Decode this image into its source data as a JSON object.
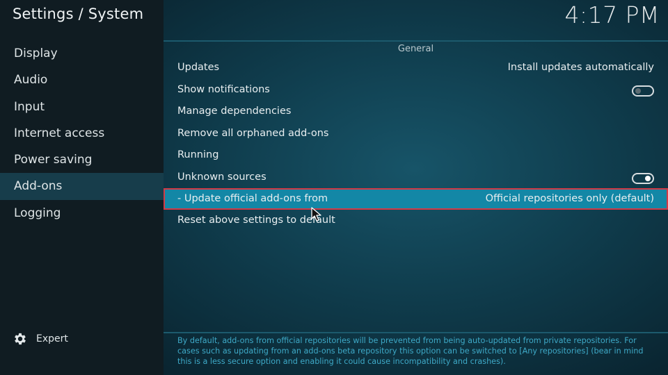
{
  "header": {
    "title": "Settings / System",
    "clock": "4:17 PM"
  },
  "sidebar": {
    "items": [
      {
        "label": "Display"
      },
      {
        "label": "Audio"
      },
      {
        "label": "Input"
      },
      {
        "label": "Internet access"
      },
      {
        "label": "Power saving"
      },
      {
        "label": "Add-ons",
        "active": true
      },
      {
        "label": "Logging"
      }
    ],
    "expert_label": "Expert",
    "expert_icon": "gear-icon"
  },
  "main": {
    "section": "General",
    "rows": [
      {
        "label": "Updates",
        "value": "Install updates automatically"
      },
      {
        "label": "Show notifications",
        "toggle": "off"
      },
      {
        "label": "Manage dependencies"
      },
      {
        "label": "Remove all orphaned add-ons"
      },
      {
        "label": "Running"
      },
      {
        "label": "Unknown sources",
        "toggle": "on"
      },
      {
        "label": "- Update official add-ons from",
        "value": "Official repositories only (default)",
        "selected": true
      },
      {
        "label": "Reset above settings to default"
      }
    ],
    "description": "By default, add-ons from official repositories will be prevented from being auto-updated from private repositories. For cases such as updating from an add-ons beta repository this option can be switched to [Any repositories] (bear in mind this is a less secure option and enabling it could cause incompatibility and crashes)."
  },
  "colors": {
    "selected_bg": "#1387a6",
    "selected_outline": "#d23a46",
    "sidebar_active": "#173d4b",
    "description_text": "#3ea9c7"
  }
}
